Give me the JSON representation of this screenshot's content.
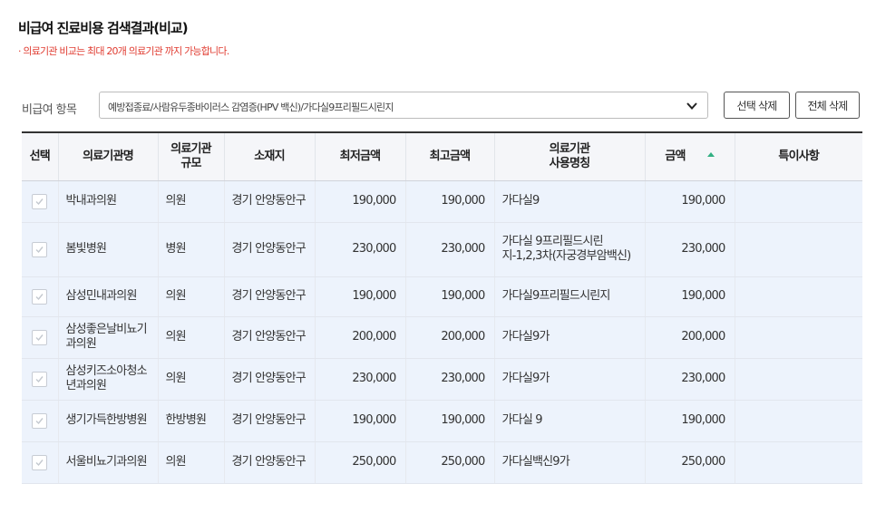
{
  "page": {
    "title": "비급여 진료비용 검색결과(비교)",
    "notice": "· 의료기관 비교는 최대 20개 의료기관 까지 가능합니다."
  },
  "filter": {
    "label": "비급여 항목",
    "selected": "예방접종료/사람유두종바이러스 감염증(HPV 백신)/가다실9프리필드시린지",
    "chevron_icon": "chevron-down-icon",
    "delete_selected_label": "선택 삭제",
    "delete_all_label": "전체 삭제"
  },
  "table": {
    "headers": [
      "선택",
      "의료기관명",
      "의료기관\n규모",
      "소재지",
      "최저금액",
      "최고금액",
      "의료기관\n사용명칭",
      "금액",
      "특이사항"
    ],
    "sort_icon": "sort-asc-icon",
    "sort_color": "#33b083",
    "rows": [
      {
        "checked": true,
        "name": "박내과의원",
        "size": "의원",
        "location": "경기 안양동안구",
        "min": "190,000",
        "max": "190,000",
        "usage_name": "가다실9",
        "price": "190,000",
        "note": ""
      },
      {
        "checked": true,
        "name": "봄빛병원",
        "size": "병원",
        "location": "경기 안양동안구",
        "min": "230,000",
        "max": "230,000",
        "usage_name": "가다실 9프리필드시린지-1,2,3차(자궁경부암백신)",
        "price": "230,000",
        "note": ""
      },
      {
        "checked": true,
        "name": "삼성민내과의원",
        "size": "의원",
        "location": "경기 안양동안구",
        "min": "190,000",
        "max": "190,000",
        "usage_name": "가다실9프리필드시린지",
        "price": "190,000",
        "note": ""
      },
      {
        "checked": true,
        "name": "삼성좋은날비뇨기과의원",
        "size": "의원",
        "location": "경기 안양동안구",
        "min": "200,000",
        "max": "200,000",
        "usage_name": "가다실9가",
        "price": "200,000",
        "note": ""
      },
      {
        "checked": true,
        "name": "삼성키즈소아청소년과의원",
        "size": "의원",
        "location": "경기 안양동안구",
        "min": "230,000",
        "max": "230,000",
        "usage_name": "가다실9가",
        "price": "230,000",
        "note": ""
      },
      {
        "checked": true,
        "name": "생기가득한방병원",
        "size": "한방병원",
        "location": "경기 안양동안구",
        "min": "190,000",
        "max": "190,000",
        "usage_name": "가다실 9",
        "price": "190,000",
        "note": ""
      },
      {
        "checked": true,
        "name": "서울비뇨기과의원",
        "size": "의원",
        "location": "경기 안양동안구",
        "min": "250,000",
        "max": "250,000",
        "usage_name": "가다실백신9가",
        "price": "250,000",
        "note": ""
      }
    ]
  }
}
